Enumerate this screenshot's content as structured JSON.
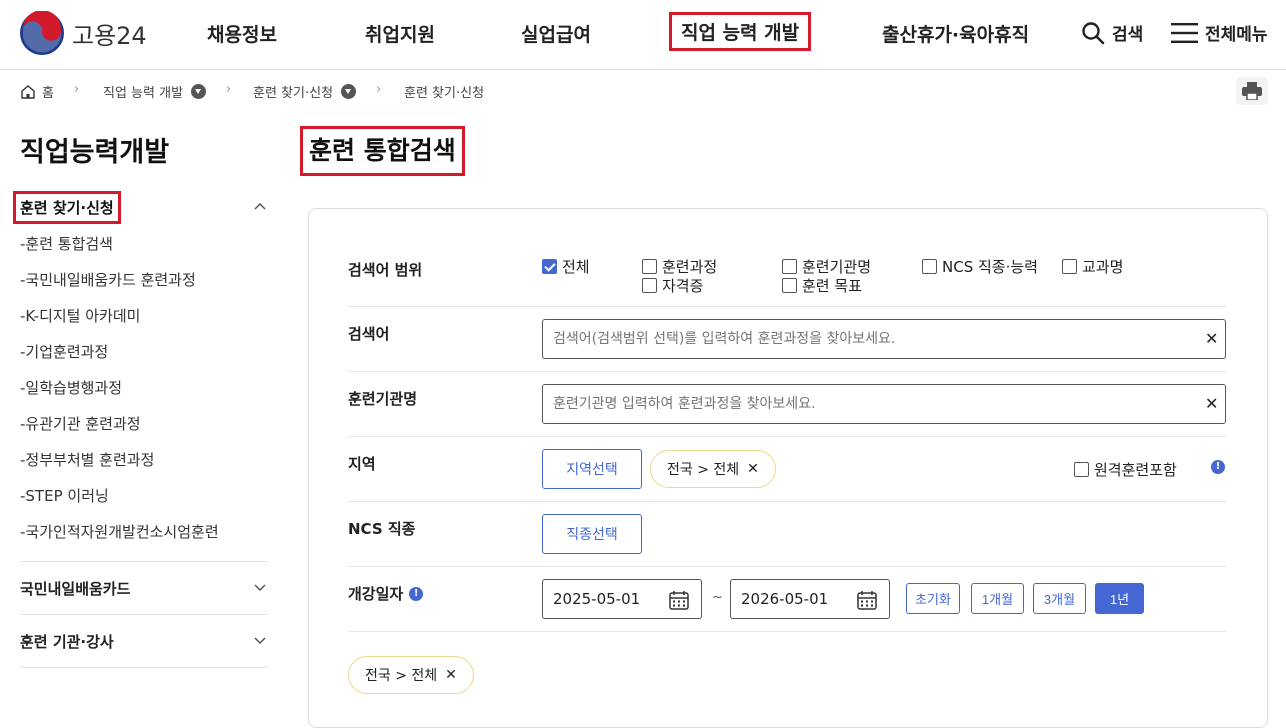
{
  "header": {
    "logo_text": "고용24",
    "nav": [
      "채용정보",
      "취업지원",
      "실업급여",
      "직업 능력 개발",
      "출산휴가·육아휴직"
    ],
    "search_label": "검색",
    "menu_label": "전체메뉴"
  },
  "breadcrumb": {
    "home": "홈",
    "level1": "직업 능력 개발",
    "level2": "훈련 찾기·신청",
    "level3": "훈련 찾기·신청"
  },
  "sidebar": {
    "title": "직업능력개발",
    "active_group": "훈련 찾기·신청",
    "sub_items": [
      "-훈련 통합검색",
      "-국민내일배움카드 훈련과정",
      "-K-디지털 아카데미",
      "-기업훈련과정",
      "-일학습병행과정",
      "-유관기관 훈련과정",
      "-정부부처별 훈련과정",
      "-STEP 이러닝",
      "-국가인적자원개발컨소시엄훈련"
    ],
    "groups": [
      "국민내일배움카드",
      "훈련 기관·강사"
    ]
  },
  "main": {
    "title": "훈련 통합검색",
    "scope": {
      "label": "검색어 범위",
      "options": [
        {
          "label": "전체",
          "checked": true
        },
        {
          "label": "훈련과정",
          "checked": false
        },
        {
          "label": "훈련기관명",
          "checked": false
        },
        {
          "label": "NCS 직종·능력",
          "checked": false
        },
        {
          "label": "교과명",
          "checked": false
        },
        {
          "label": "자격증",
          "checked": false
        },
        {
          "label": "훈련 목표",
          "checked": false
        }
      ]
    },
    "keyword": {
      "label": "검색어",
      "placeholder": "검색어(검색범위 선택)를 입력하여 훈련과정을 찾아보세요."
    },
    "institution": {
      "label": "훈련기관명",
      "placeholder": "훈련기관명 입력하여 훈련과정을 찾아보세요."
    },
    "region": {
      "label": "지역",
      "button": "지역선택",
      "chip": "전국 > 전체",
      "remote_label": "원격훈련포함"
    },
    "ncs": {
      "label": "NCS 직종",
      "button": "직종선택"
    },
    "date": {
      "label": "개강일자",
      "start": "2025-05-01",
      "separator": "~",
      "end": "2026-05-01",
      "buttons": [
        "초기화",
        "1개월",
        "3개월",
        "1년"
      ],
      "selected": "1년"
    },
    "selected_chip": "전국 > 전체"
  }
}
